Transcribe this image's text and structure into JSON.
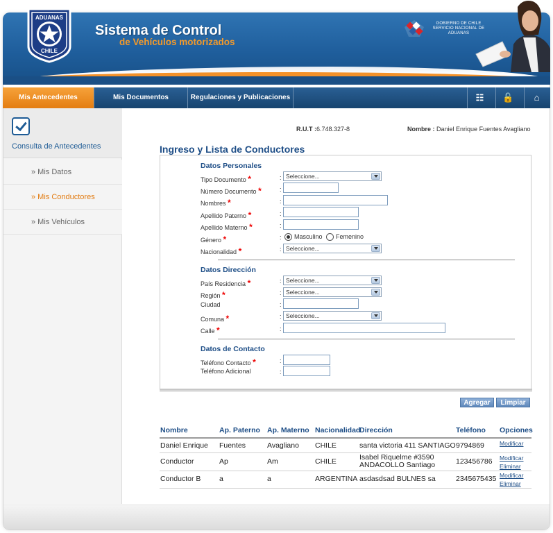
{
  "header": {
    "logo_text_top": "ADUANAS",
    "logo_text_bottom": "CHILE",
    "title": "Sistema de Control",
    "subtitle": "de Vehículos motorizados",
    "gov_text": "GOBIERNO DE CHILE SERVICIO NACIONAL DE ADUANAS"
  },
  "nav": {
    "items": [
      {
        "label": "Mis Antecedentes"
      },
      {
        "label": "Mis Documentos"
      },
      {
        "label": "Regulaciones y Publicaciones"
      }
    ],
    "icons": [
      "book-icon",
      "lock-icon",
      "home-icon"
    ]
  },
  "sidebar": {
    "title": "Consulta de Antecedentes",
    "items": [
      {
        "label": "» Mis Datos"
      },
      {
        "label": "» Mis Conductores"
      },
      {
        "label": "» Mis Vehículos"
      }
    ]
  },
  "user": {
    "rut_label": "R.U.T :",
    "rut_value": "6.748.327-8",
    "name_label": "Nombre :",
    "name_value": "Daniel Enrique Fuentes Avagliano"
  },
  "page_title": "Ingreso y Lista de Conductores",
  "form": {
    "sections": {
      "personal": "Datos Personales",
      "address": "Datos Dirección",
      "contact": "Datos de Contacto"
    },
    "labels": {
      "tipo_documento": "Tipo Documento",
      "numero_documento": "Número Documento",
      "nombres": "Nombres",
      "apellido_paterno": "Apellido Paterno",
      "apellido_materno": "Apellido Materno",
      "genero": "Género",
      "nacionalidad": "Nacionalidad",
      "pais_residencia": "País Residencia",
      "region": "Región",
      "ciudad": "Ciudad",
      "comuna": "Comuna",
      "calle": "Calle",
      "telefono_contacto": "Teléfono Contacto",
      "telefono_adicional": "Teléfono Adicional"
    },
    "select_placeholder": "Seleccione...",
    "required_mark": "*",
    "colon": ":",
    "genero_options": {
      "masculino": "Masculino",
      "femenino": "Femenino",
      "selected": "Masculino"
    }
  },
  "buttons": {
    "agregar": "Agregar",
    "limpiar": "Limpiar"
  },
  "table": {
    "headers": [
      "Nombre",
      "Ap. Paterno",
      "Ap. Materno",
      "Nacionalidad",
      "Dirección",
      "Teléfono",
      "Opciones"
    ],
    "rows": [
      {
        "nombre": "Daniel Enrique",
        "ap_paterno": "Fuentes",
        "ap_materno": "Avagliano",
        "nacionalidad": "CHILE",
        "direccion": "santa victoria 411 SANTIAGO",
        "telefono": "9794869",
        "opciones": [
          "Modificar"
        ]
      },
      {
        "nombre": "Conductor",
        "ap_paterno": "Ap",
        "ap_materno": "Am",
        "nacionalidad": "CHILE",
        "direccion": "Isabel Riquelme #3590 ANDACOLLO Santiago",
        "telefono": "123456786",
        "opciones": [
          "Modificar",
          "Eliminar"
        ]
      },
      {
        "nombre": "Conductor B",
        "ap_paterno": "a",
        "ap_materno": "a",
        "nacionalidad": "ARGENTINA",
        "direccion": "asdasdsad BULNES sa",
        "telefono": "2345675435",
        "opciones": [
          "Modificar",
          "Eliminar"
        ]
      }
    ]
  }
}
